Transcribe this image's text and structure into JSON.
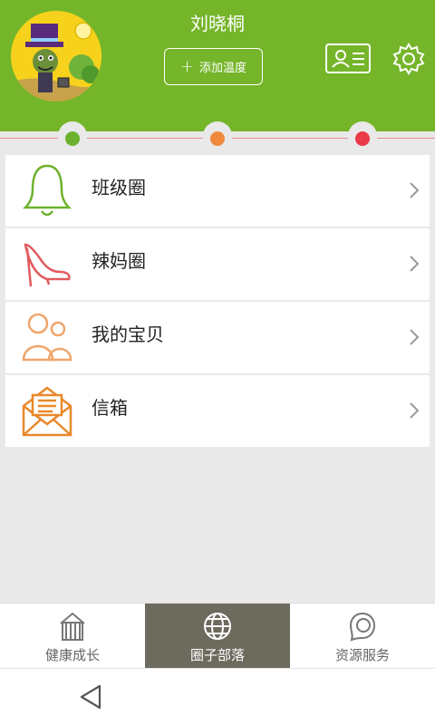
{
  "header": {
    "username": "刘晓桐",
    "add_button_label": "添加温度",
    "avatar_icon": "cartoon-avatar",
    "id_card_icon": "id-card-icon",
    "settings_icon": "gear-icon"
  },
  "colors": {
    "header_bg": "#75b52a",
    "track_dot_1": "#6db22e",
    "track_dot_2": "#ef8a3c",
    "track_dot_3": "#ea3a48",
    "active_tab_bg": "#6d6a5e"
  },
  "menu": {
    "items": [
      {
        "label": "班级圈",
        "icon": "bell-icon",
        "color": "#6db22e"
      },
      {
        "label": "辣妈圈",
        "icon": "high-heel-icon",
        "color": "#e25a5f"
      },
      {
        "label": "我的宝贝",
        "icon": "people-icon",
        "color": "#f0a56a"
      },
      {
        "label": "信箱",
        "icon": "mail-icon",
        "color": "#e8892c"
      }
    ]
  },
  "tabs": [
    {
      "label": "健康成长",
      "icon": "house-icon",
      "active": false
    },
    {
      "label": "圈子部落",
      "icon": "globe-icon",
      "active": true
    },
    {
      "label": "资源服务",
      "icon": "chat-bubble-icon",
      "active": false
    }
  ],
  "system_nav": {
    "back_icon": "back-triangle-icon"
  }
}
